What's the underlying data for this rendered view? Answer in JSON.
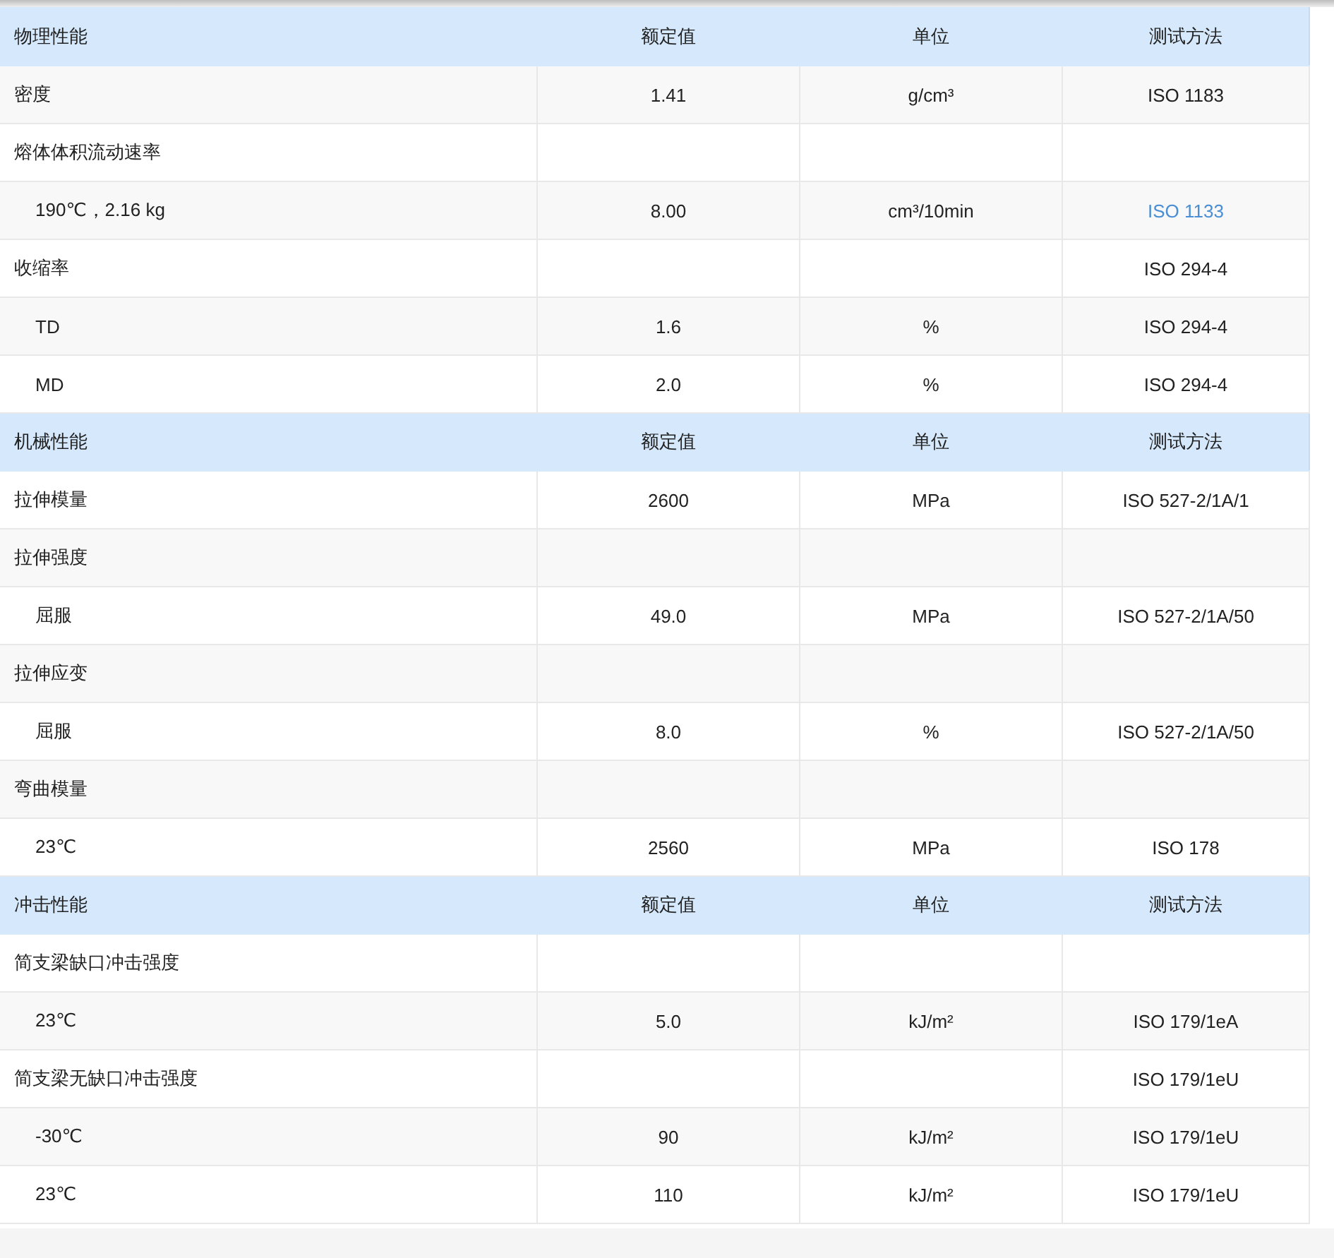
{
  "sections": [
    {
      "columns": [
        "物理性能",
        "额定值",
        "单位",
        "测试方法"
      ],
      "rows": [
        {
          "name": "密度",
          "value": "1.41",
          "unit": "g/cm³",
          "method": "ISO 1183",
          "method_link": false
        },
        {
          "name": "熔体体积流动速率",
          "children": [
            {
              "name": "190℃，2.16 kg",
              "value": "8.00",
              "unit": "cm³/10min",
              "method": "ISO 1133",
              "method_link": true
            }
          ]
        },
        {
          "name": "收缩率",
          "method": "ISO 294-4",
          "method_link": false,
          "children": [
            {
              "name": "TD",
              "value": "1.6",
              "unit": "%",
              "method": "ISO 294-4",
              "method_link": false
            },
            {
              "name": "MD",
              "value": "2.0",
              "unit": "%",
              "method": "ISO 294-4",
              "method_link": false
            }
          ]
        }
      ]
    },
    {
      "columns": [
        "机械性能",
        "额定值",
        "单位",
        "测试方法"
      ],
      "rows": [
        {
          "name": "拉伸模量",
          "value": "2600",
          "unit": "MPa",
          "method": "ISO 527-2/1A/1",
          "method_link": false
        },
        {
          "name": "拉伸强度",
          "children": [
            {
              "name": "屈服",
              "value": "49.0",
              "unit": "MPa",
              "method": "ISO 527-2/1A/50",
              "method_link": false
            }
          ]
        },
        {
          "name": "拉伸应变",
          "children": [
            {
              "name": "屈服",
              "value": "8.0",
              "unit": "%",
              "method": "ISO 527-2/1A/50",
              "method_link": false
            }
          ]
        },
        {
          "name": "弯曲模量",
          "children": [
            {
              "name": "23℃",
              "value": "2560",
              "unit": "MPa",
              "method": "ISO 178",
              "method_link": false
            }
          ]
        }
      ]
    },
    {
      "columns": [
        "冲击性能",
        "额定值",
        "单位",
        "测试方法"
      ],
      "rows": [
        {
          "name": "简支梁缺口冲击强度",
          "children": [
            {
              "name": "23℃",
              "value": "5.0",
              "unit": "kJ/m²",
              "method": "ISO 179/1eA",
              "method_link": false
            }
          ]
        },
        {
          "name": "简支梁无缺口冲击强度",
          "method": "ISO 179/1eU",
          "method_link": false,
          "children": [
            {
              "name": "-30℃",
              "value": "90",
              "unit": "kJ/m²",
              "method": "ISO 179/1eU",
              "method_link": false
            },
            {
              "name": "23℃",
              "value": "110",
              "unit": "kJ/m²",
              "method": "ISO 179/1eU",
              "method_link": false
            }
          ]
        }
      ]
    }
  ]
}
